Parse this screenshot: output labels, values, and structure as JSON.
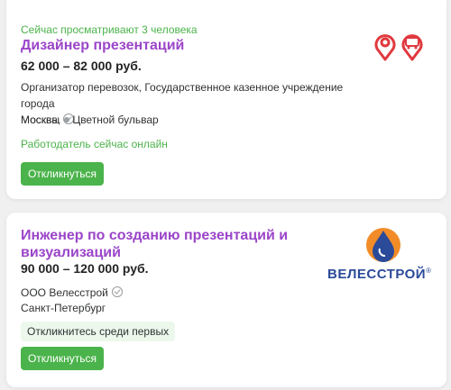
{
  "vacancies": [
    {
      "viewers": "Сейчас просматривают 3 человека",
      "title": "Дизайнер презентаций",
      "salary": "62 000 – 82 000 руб.",
      "employer_line1": "Организатор перевозок, Государственное казенное учреждение города",
      "employer_line2": "Москвы",
      "city": "Москва,",
      "metro": "Цветной бульвар",
      "employer_status": "Работодатель сейчас онлайн",
      "respond_label": "Откликнуться"
    },
    {
      "title_line1": "Инженер по созданию презентаций и",
      "title_line2": "визуализаций",
      "salary": "90 000 – 120 000 руб.",
      "employer": "ООО Велесстрой",
      "city": "Санкт-Петербург",
      "badge": "Откликнитесь среди первых",
      "respond_label": "Откликнуться",
      "logo_text": "ВЕЛЕССТРОЙ",
      "logo_mark": "®"
    }
  ],
  "colors": {
    "title": "#9b45c9",
    "accent_green": "#4bb34b",
    "logo_red": "#e0393e",
    "logo_blue": "#2b4a9a",
    "logo_orange": "#f28c28"
  }
}
